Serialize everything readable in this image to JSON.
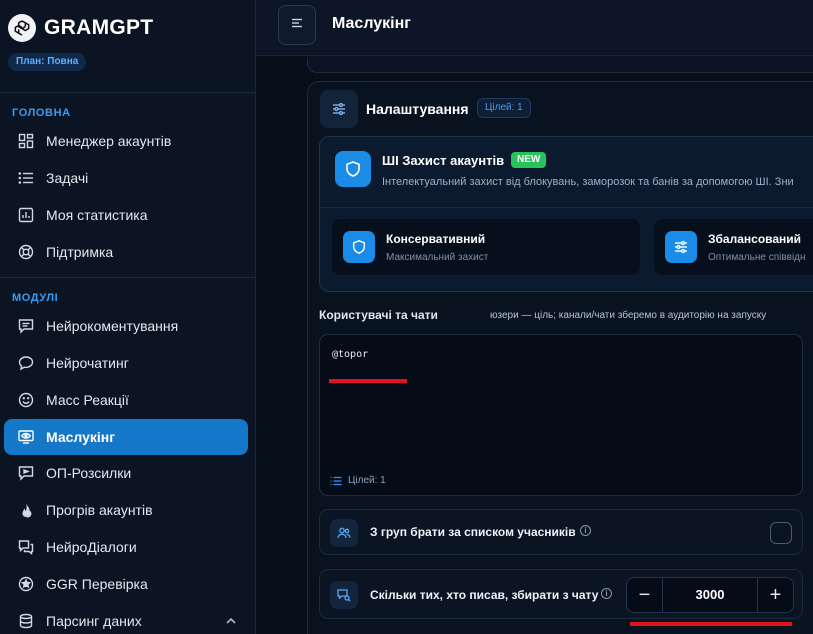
{
  "brand": {
    "name": "GRAMGPT",
    "plan": "План: Повна"
  },
  "sidebar": {
    "section_main": "ГОЛОВНА",
    "main_items": [
      {
        "label": "Менеджер акаунтів",
        "icon": "grid-icon"
      },
      {
        "label": "Задачі",
        "icon": "list-icon"
      },
      {
        "label": "Моя статистика",
        "icon": "chart-icon"
      },
      {
        "label": "Підтримка",
        "icon": "lifebuoy-icon"
      }
    ],
    "section_modules": "МОДУЛІ",
    "module_items": [
      {
        "label": "Нейрокоментування",
        "icon": "comments-icon"
      },
      {
        "label": "Нейрочатинг",
        "icon": "chat-bubble-icon"
      },
      {
        "label": "Масс Реакції",
        "icon": "smile-icon"
      },
      {
        "label": "Маслукінг",
        "icon": "monitor-eye-icon",
        "active": true
      },
      {
        "label": "ОП-Розсилки",
        "icon": "send-icon"
      },
      {
        "label": "Прогрів акаунтів",
        "icon": "flame-icon"
      },
      {
        "label": "НейроДіалоги",
        "icon": "dialogs-icon"
      },
      {
        "label": "GGR Перевірка",
        "icon": "star-badge-icon"
      },
      {
        "label": "Парсинг даних",
        "icon": "database-icon"
      }
    ]
  },
  "header": {
    "title": "Маслукінг"
  },
  "settings": {
    "title": "Налаштування",
    "targets_badge": "Цілей: 1",
    "ai_protection": {
      "title": "ШІ Захист акаунтів",
      "badge": "NEW",
      "description": "Інтелектуальний захист від блокувань, заморозок та банів за допомогою ШІ. Зни"
    },
    "modes": [
      {
        "title": "Консервативний",
        "subtitle": "Максимальний захист"
      },
      {
        "title": "Збалансований",
        "subtitle": "Оптимальне співвідн"
      }
    ],
    "users": {
      "label": "Користувачі та чати",
      "hint": "юзери — ціль; канали/чати зберемо в аудиторію на запуску",
      "value": "@topor",
      "targets_count": "Цілей: 1"
    },
    "option_groups": {
      "label": "З груп брати за списком учасників",
      "checked": false
    },
    "option_writers": {
      "label": "Скільки тих, хто писав, збирати з чату",
      "value": "3000",
      "minus": "−",
      "plus": "+"
    }
  },
  "colors": {
    "accent": "#1477c8",
    "new_badge": "#27c35a",
    "section": "#3a9bef",
    "highlight_line": "#e3121b"
  }
}
